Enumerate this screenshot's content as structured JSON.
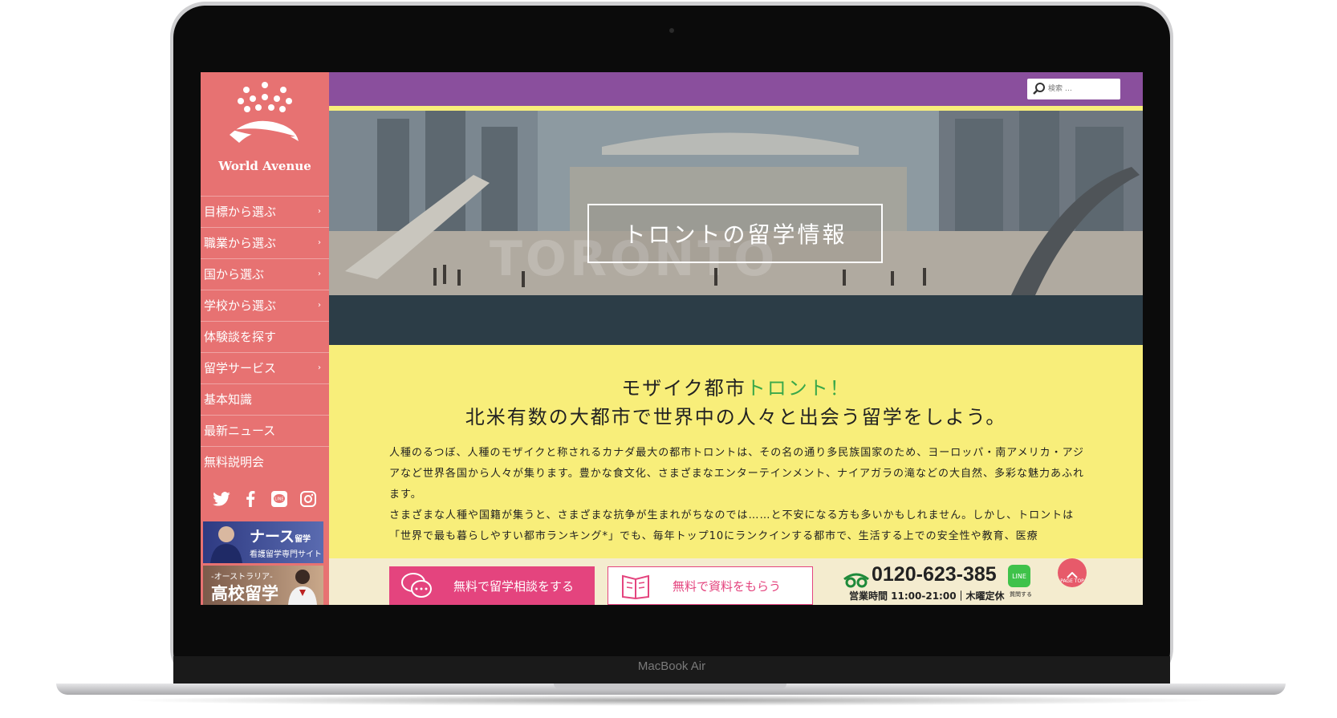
{
  "device": {
    "brand_label": "MacBook Air"
  },
  "sidebar": {
    "logo_text": "World Avenue",
    "nav": [
      {
        "label": "目標から選ぶ",
        "arrow": true
      },
      {
        "label": "職業から選ぶ",
        "arrow": true
      },
      {
        "label": "国から選ぶ",
        "arrow": true
      },
      {
        "label": "学校から選ぶ",
        "arrow": true
      },
      {
        "label": "体験談を探す",
        "arrow": false
      },
      {
        "label": "留学サービス",
        "arrow": true
      },
      {
        "label": "基本知識",
        "arrow": false
      },
      {
        "label": "最新ニュース",
        "arrow": false
      },
      {
        "label": "無料説明会",
        "arrow": false
      }
    ],
    "arrow_glyph": "›",
    "social_icons": [
      "twitter-icon",
      "facebook-icon",
      "line-icon",
      "instagram-icon"
    ],
    "banners": {
      "nurse": {
        "title": "ナース",
        "suffix": "留学",
        "sub": "看護留学専門サイト"
      },
      "highschool": {
        "sub": "-オーストラリア-",
        "title": "高校留学"
      }
    }
  },
  "header": {
    "search_placeholder": "検索 …"
  },
  "hero": {
    "title": "トロントの留学情報"
  },
  "main": {
    "headline_line1_prefix": "モザイク都市",
    "headline_line1_accent": "トロント！",
    "headline_line2": "北米有数の大都市で世界中の人々と出会う留学をしよう。",
    "paragraph1": "人種のるつぼ、人種のモザイクと称されるカナダ最大の都市トロントは、その名の通り多民族国家のため、ヨーロッパ・南アメリカ・アジアなど世界各国から人々が集ります。豊かな食文化、さまざまなエンターテインメント、ナイアガラの滝などの大自然、多彩な魅力あふれます。",
    "paragraph2": "さまざまな人種や国籍が集うと、さまざまな抗争が生まれがちなのでは……と不安になる方も多いかもしれません。しかし、トロントは「世界で最も暮らしやすい都市ランキング*」でも、毎年トップ10にランクインする都市で、生活する上での安全性や教育、医療"
  },
  "footer_bar": {
    "consult_button": "無料で留学相談をする",
    "brochure_button": "無料で資料をもらう",
    "phone": "0120-623-385",
    "hours": "営業時間 11:00-21:00｜木曜定休",
    "line_label": "LINE",
    "line_caption": "質問する",
    "page_top": "PAGE TOP"
  },
  "colors": {
    "sidebar": "#e77272",
    "topbar": "#8a4f9d",
    "content_bg": "#f8ee7a",
    "accent_green": "#3aa84a",
    "cta_pink": "#e4447e"
  }
}
